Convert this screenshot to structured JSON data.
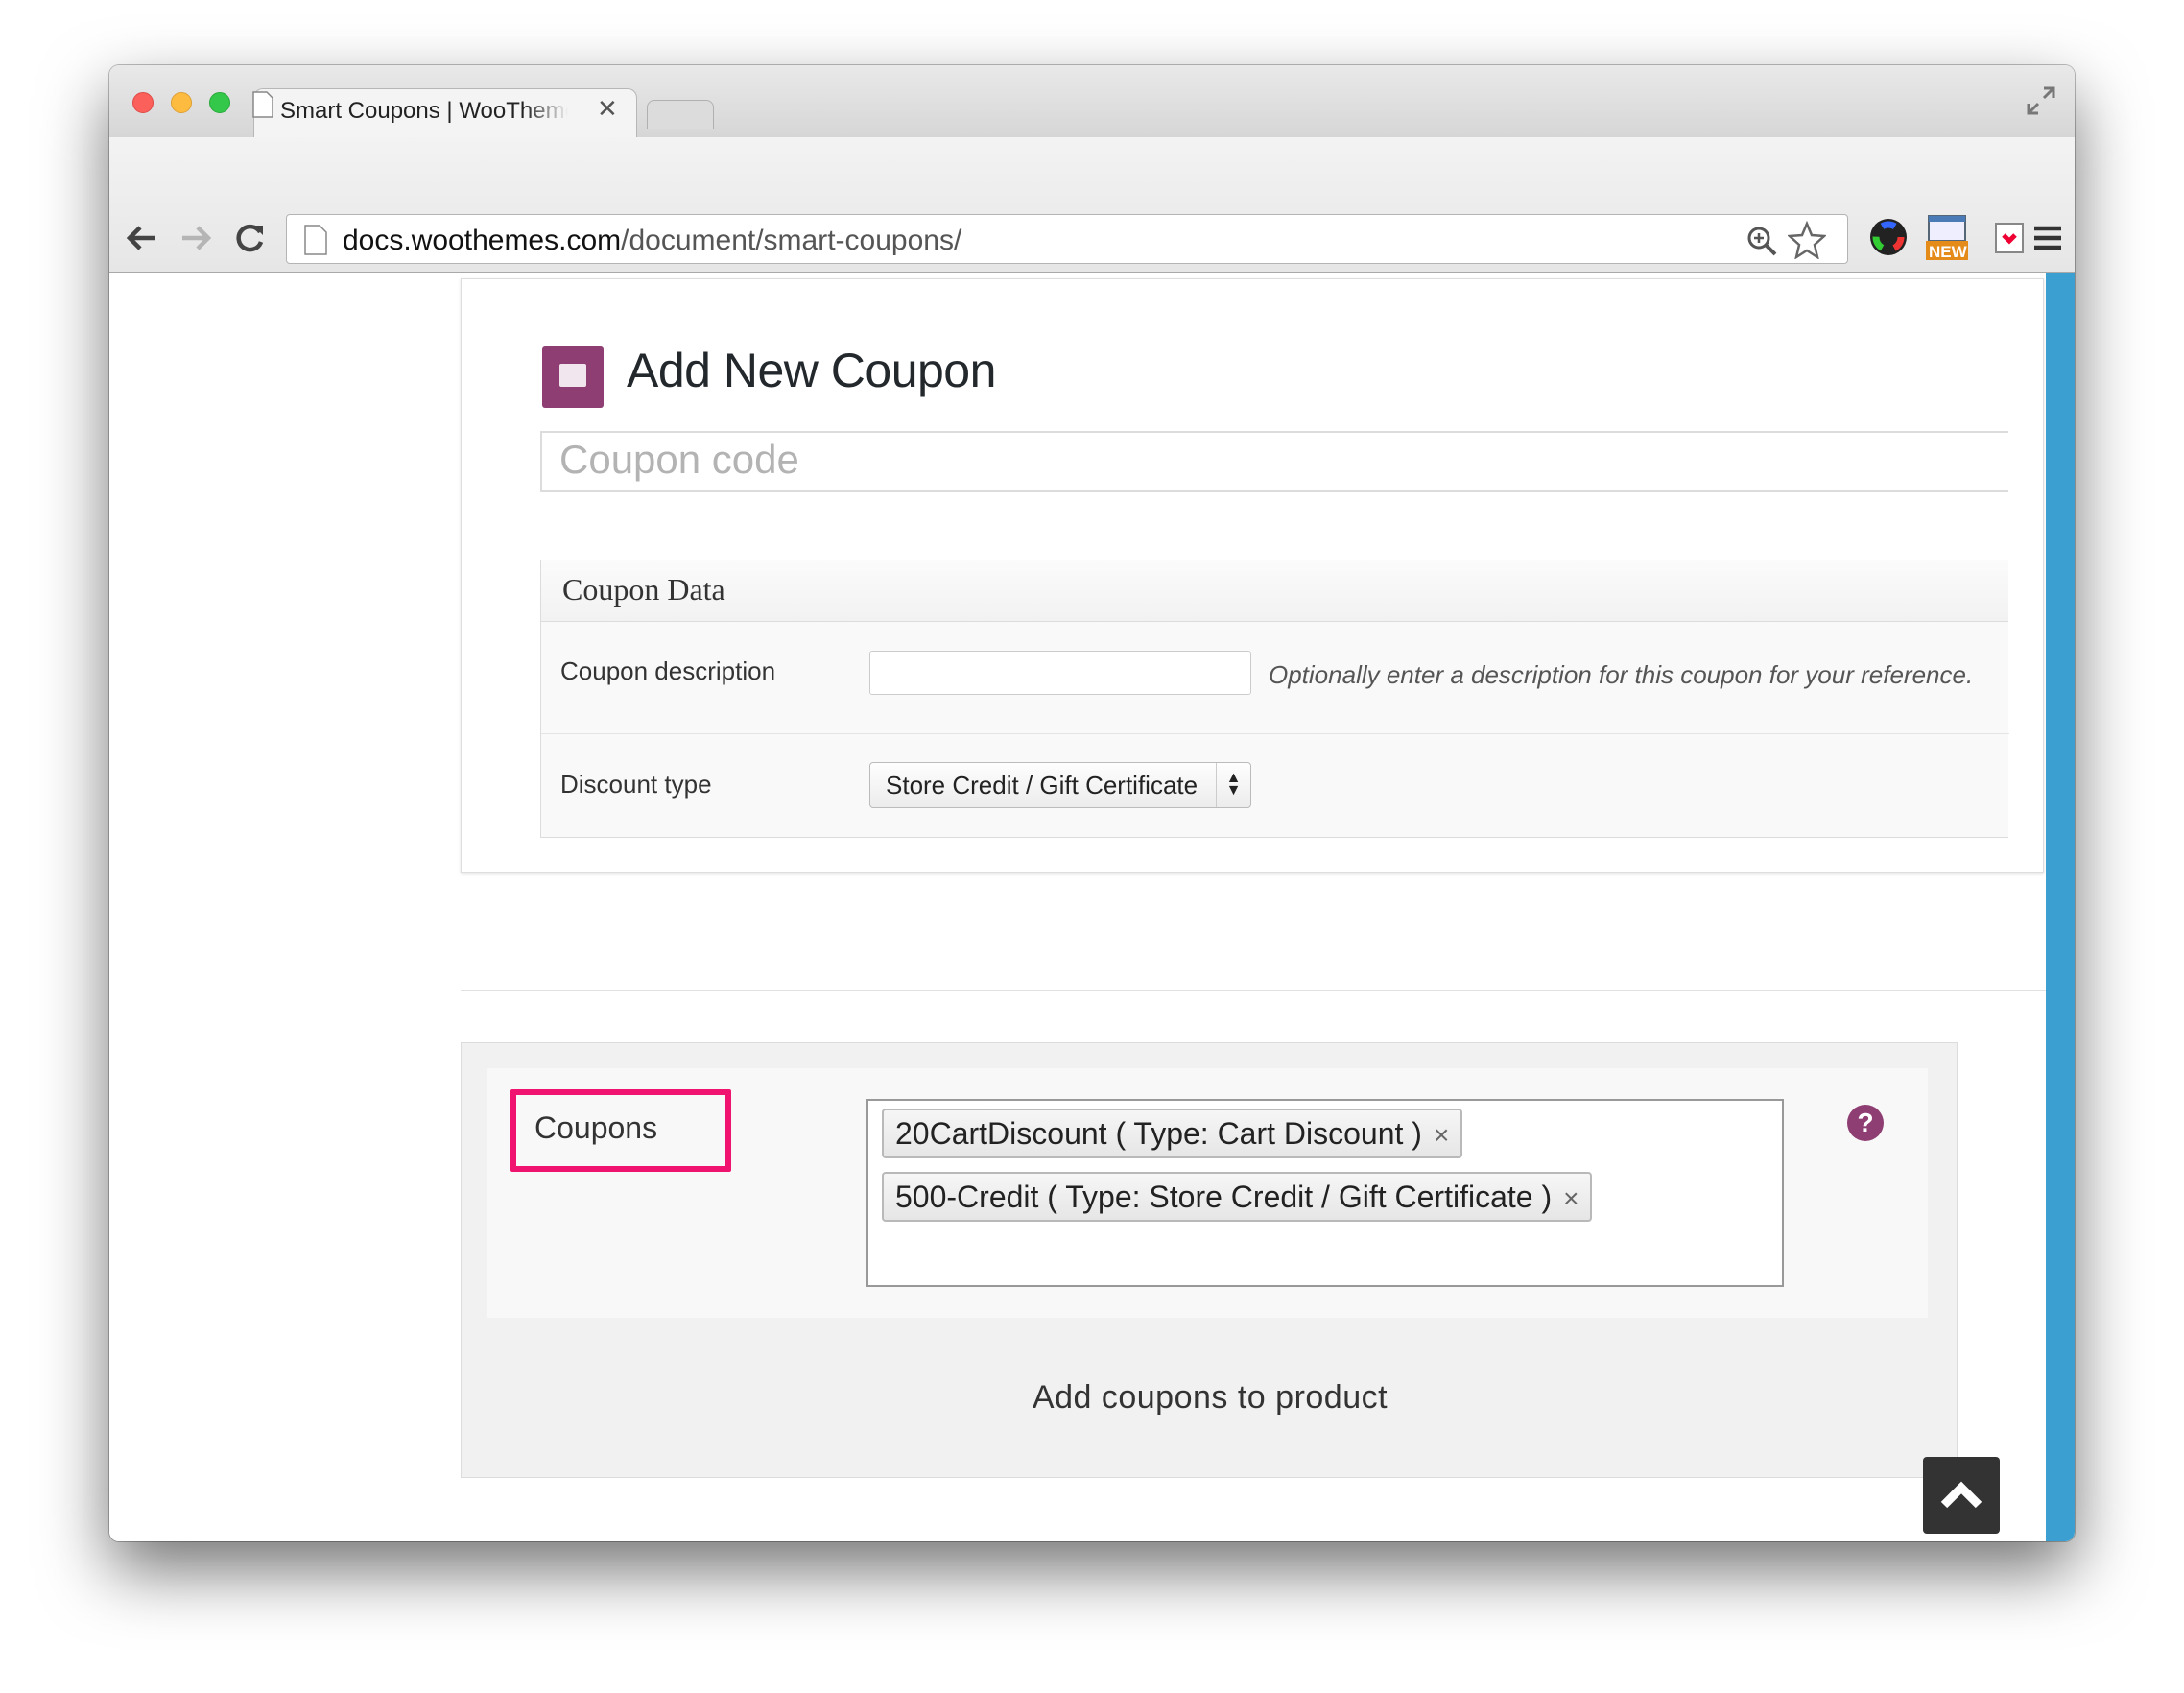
{
  "browser": {
    "tab_title": "Smart Coupons | WooThemes",
    "url_host": "docs.woothemes.com",
    "url_path": "/document/smart-coupons/",
    "ext_badge": "NEW"
  },
  "page": {
    "heading": "Add New Coupon",
    "coupon_code_placeholder": "Coupon code",
    "coupon_data": {
      "title": "Coupon Data",
      "description_label": "Coupon description",
      "description_value": "",
      "description_hint": "Optionally enter a description for this coupon for your reference.",
      "discount_type_label": "Discount type",
      "discount_type_value": "Store Credit / Gift Certificate"
    },
    "product_coupons": {
      "label": "Coupons",
      "tags": [
        {
          "text": "20CartDiscount ( Type: Cart Discount )",
          "remove": "×"
        },
        {
          "text": "500-Credit ( Type: Store Credit / Gift Certificate )",
          "remove": "×"
        }
      ],
      "help_glyph": "?",
      "caption": "Add coupons to product"
    }
  },
  "colors": {
    "accent_purple": "#8e3e72",
    "highlight_pink": "#f0136f",
    "scrollbar_blue": "#3b9fd1"
  },
  "icons": [
    "back-arrow-icon",
    "forward-arrow-icon",
    "reload-icon",
    "page-icon",
    "zoom-icon",
    "star-icon",
    "color-wheel-icon",
    "new-extension-icon",
    "pocket-icon",
    "menu-icon",
    "coupon-icon",
    "help-icon",
    "chevron-up-icon",
    "fullscreen-icon"
  ]
}
